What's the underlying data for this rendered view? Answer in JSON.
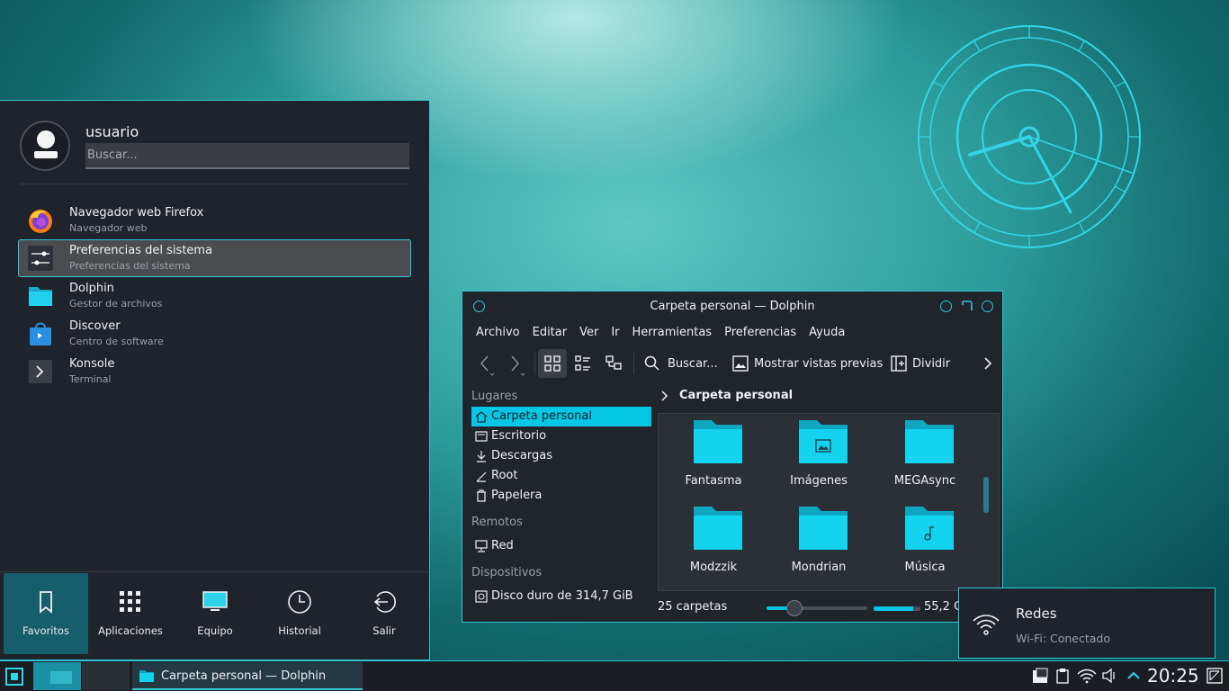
{
  "launcher": {
    "username": "usuario",
    "search_placeholder": "Buscar...",
    "apps": [
      {
        "name": "Navegador web Firefox",
        "desc": "Navegador web",
        "icon": "firefox-icon"
      },
      {
        "name": "Preferencias del sistema",
        "desc": "Preferencias del sistema",
        "icon": "settings-icon"
      },
      {
        "name": "Dolphin",
        "desc": "Gestor de archivos",
        "icon": "folder-icon"
      },
      {
        "name": "Discover",
        "desc": "Centro de software",
        "icon": "discover-icon"
      },
      {
        "name": "Konsole",
        "desc": "Terminal",
        "icon": "terminal-icon"
      }
    ],
    "tabs": [
      {
        "label": "Favoritos",
        "icon": "bookmark-icon"
      },
      {
        "label": "Aplicaciones",
        "icon": "grid-icon"
      },
      {
        "label": "Equipo",
        "icon": "monitor-icon"
      },
      {
        "label": "Historial",
        "icon": "clock-icon"
      },
      {
        "label": "Salir",
        "icon": "logout-icon"
      }
    ]
  },
  "dolphin": {
    "title": "Carpeta personal — Dolphin",
    "menus": [
      "Archivo",
      "Editar",
      "Ver",
      "Ir",
      "Herramientas",
      "Preferencias",
      "Ayuda"
    ],
    "toolbar": {
      "search": "Buscar...",
      "previews": "Mostrar vistas previas",
      "split": "Dividir"
    },
    "places": {
      "heading": "Lugares",
      "items": [
        "Carpeta personal",
        "Escritorio",
        "Descargas",
        "Root",
        "Papelera"
      ],
      "remote_heading": "Remotos",
      "remote_items": [
        "Red"
      ],
      "devices_heading": "Dispositivos",
      "device_items": [
        "Disco duro de 314,7 GiB"
      ]
    },
    "breadcrumb": "Carpeta personal",
    "files": [
      {
        "name": "Fantasma",
        "emblem": ""
      },
      {
        "name": "Imágenes",
        "emblem": "image"
      },
      {
        "name": "MEGAsync",
        "emblem": ""
      },
      {
        "name": "Modzzik",
        "emblem": ""
      },
      {
        "name": "Mondrian",
        "emblem": ""
      },
      {
        "name": "Música",
        "emblem": "music"
      }
    ],
    "status": {
      "count": "25 carpetas",
      "zoom_level": 0.28,
      "free_space": "55,2 G",
      "space_used": 0.85
    }
  },
  "network_popup": {
    "title": "Redes",
    "status": "Wi-Fi: Conectado"
  },
  "taskbar": {
    "task_label": "Carpeta personal — Dolphin",
    "clock": "20:25"
  },
  "colors": {
    "accent": "#2fc4d6",
    "highlight": "#06c6e6",
    "panel_bg": "#1f232b"
  }
}
